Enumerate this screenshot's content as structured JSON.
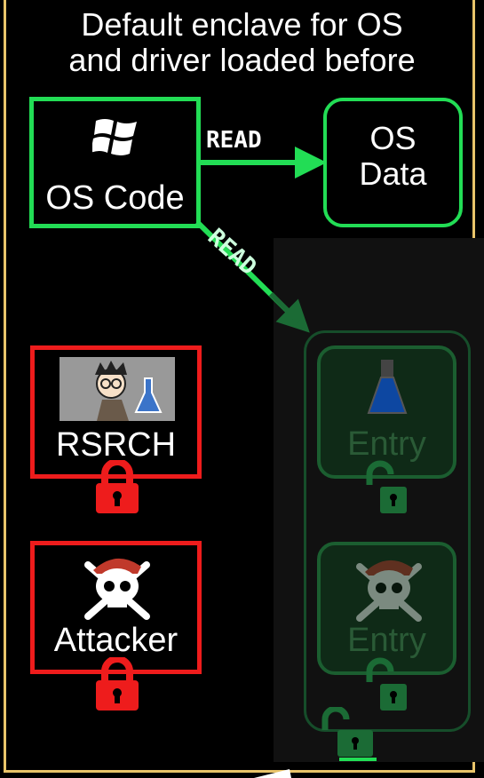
{
  "title": "Default enclave for OS\nand driver loaded before",
  "os_code": {
    "label": "OS Code",
    "icon": "windows-logo-icon"
  },
  "os_data": {
    "label": "OS\nData"
  },
  "arrows": {
    "read_to_data": "READ",
    "read_to_enclave": "READ"
  },
  "rsrch": {
    "label": "RSRCH",
    "icon": "researcher-icon",
    "lock": "locked-padlock-icon"
  },
  "attacker": {
    "label": "Attacker",
    "icon": "pirate-skull-icon",
    "lock": "locked-padlock-icon"
  },
  "enclave": {
    "entries": [
      {
        "label": "Entry",
        "icon": "flask-icon",
        "lock": "unlocked-padlock-icon"
      },
      {
        "label": "Entry",
        "icon": "pirate-skull-icon",
        "lock": "unlocked-padlock-icon"
      }
    ],
    "outer_lock": "unlocked-padlock-icon"
  },
  "colors": {
    "trusted": "#22dd55",
    "untrusted": "#ee1c1c",
    "frame": "#e9c46a",
    "dim_enclave": "#1b5e30"
  }
}
